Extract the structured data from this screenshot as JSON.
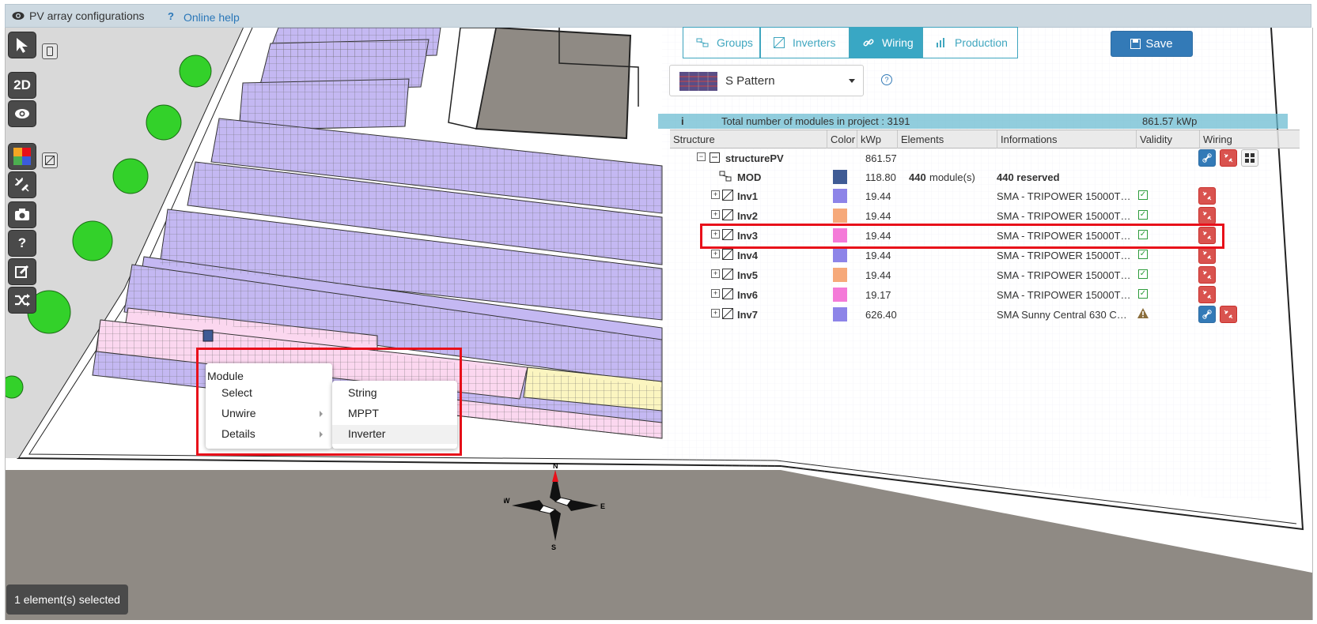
{
  "header": {
    "title": "PV array configurations",
    "help_link": "Online help"
  },
  "toolbar": {
    "view_2d_label": "2D",
    "help_label": "?"
  },
  "tabs": [
    {
      "label": "Groups",
      "active": false
    },
    {
      "label": "Inverters",
      "active": false
    },
    {
      "label": "Wiring",
      "active": true
    },
    {
      "label": "Production",
      "active": false
    }
  ],
  "save_label": "Save",
  "pattern": {
    "selected": "S Pattern"
  },
  "info": {
    "text": "Total number of modules in project : 3191",
    "kwp": "861.57 kWp"
  },
  "table": {
    "columns": [
      "Structure",
      "Color",
      "kWp",
      "Elements",
      "Informations",
      "Validity",
      "Wiring"
    ],
    "root": {
      "name": "structurePV",
      "kwp": "861.57"
    },
    "mod": {
      "name": "MOD",
      "kwp": "118.80",
      "elements_count": "440",
      "elements_unit": "module(s)",
      "info": "440 reserved",
      "color": "#3f5b95"
    },
    "rows": [
      {
        "name": "Inv1",
        "kwp": "19.44",
        "info": "SMA - TRIPOWER 15000T…",
        "color": "#8d84e8",
        "valid": true
      },
      {
        "name": "Inv2",
        "kwp": "19.44",
        "info": "SMA - TRIPOWER 15000T…",
        "color": "#f6a97a",
        "valid": true
      },
      {
        "name": "Inv3",
        "kwp": "19.44",
        "info": "SMA - TRIPOWER 15000T…",
        "color": "#f47ad8",
        "valid": true
      },
      {
        "name": "Inv4",
        "kwp": "19.44",
        "info": "SMA - TRIPOWER 15000T…",
        "color": "#8d84e8",
        "valid": true
      },
      {
        "name": "Inv5",
        "kwp": "19.44",
        "info": "SMA - TRIPOWER 15000T…",
        "color": "#f6a97a",
        "valid": true
      },
      {
        "name": "Inv6",
        "kwp": "19.17",
        "info": "SMA - TRIPOWER 15000T…",
        "color": "#f47ad8",
        "valid": true
      },
      {
        "name": "Inv7",
        "kwp": "626.40",
        "info": "SMA Sunny Central 630 C…",
        "color": "#8d84e8",
        "valid": false
      }
    ]
  },
  "context_menu": {
    "header": "Module",
    "items": [
      "Select",
      "Unwire",
      "Details"
    ],
    "submenu": [
      "String",
      "MPPT",
      "Inverter"
    ]
  },
  "compass": {
    "n": "N",
    "e": "E",
    "s": "S",
    "w": "W"
  },
  "status": "1 element(s) selected"
}
